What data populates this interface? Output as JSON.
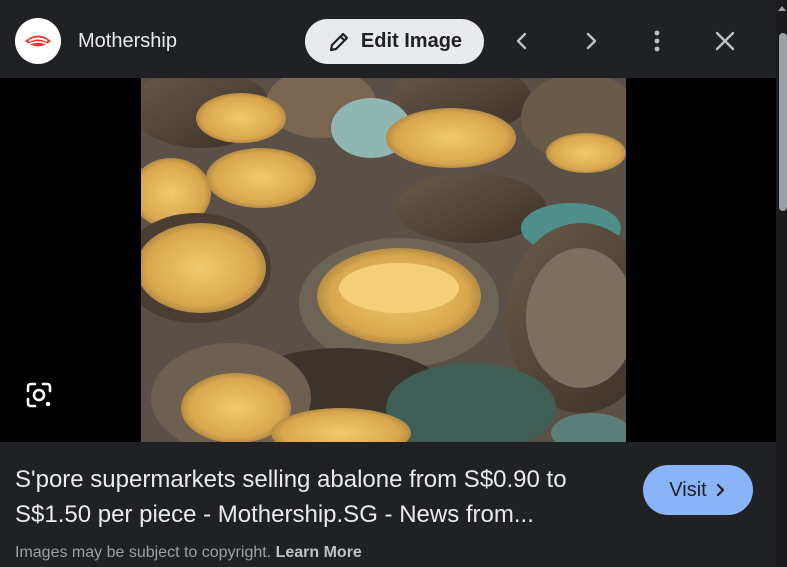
{
  "header": {
    "site_name": "Mothership",
    "logo_icon": "mothership-logo",
    "edit_label": "Edit Image",
    "edit_icon": "pencil-icon",
    "prev_icon": "chevron-left-icon",
    "next_icon": "chevron-right-icon",
    "more_icon": "more-vert-icon",
    "close_icon": "close-icon"
  },
  "image": {
    "alt": "abalone",
    "lens_icon": "lens-icon"
  },
  "result": {
    "title": "S'pore supermarkets selling abalone from S$0.90 to S$1.50 per piece - Mothership.SG - News from...",
    "visit_label": "Visit",
    "visit_icon": "chevron-right-icon"
  },
  "footer": {
    "copyright_text": "Images may be subject to copyright.",
    "learn_more": "Learn More"
  },
  "colors": {
    "background": "#202124",
    "accent": "#8ab4f8",
    "logo_red": "#e8372f"
  }
}
